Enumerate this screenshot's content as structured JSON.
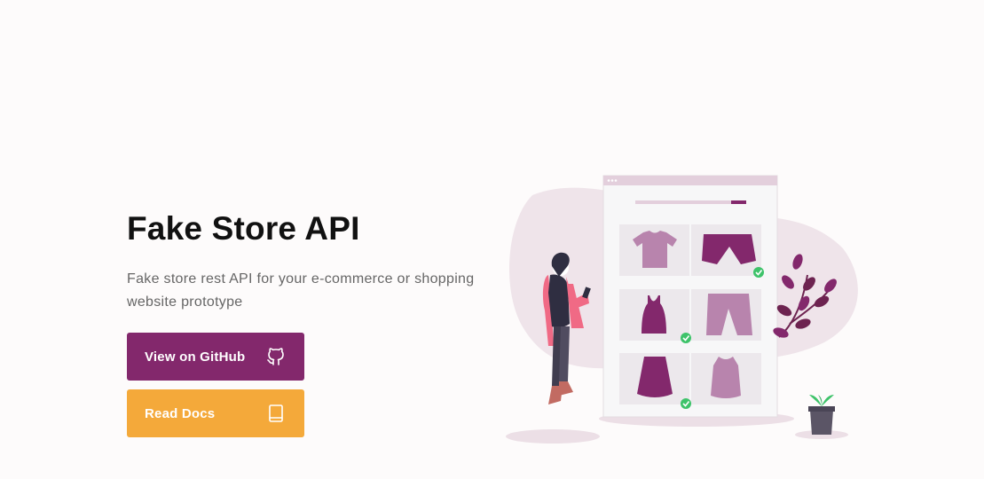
{
  "hero": {
    "title": "Fake Store API",
    "subtitle": "Fake store rest API for your e-commerce or shopping website prototype"
  },
  "buttons": {
    "github_label": "View on GitHub",
    "github_icon": "github-icon",
    "docs_label": "Read Docs",
    "docs_icon": "book-icon"
  },
  "colors": {
    "primary": "#83286c",
    "secondary": "#f4a93a",
    "background": "#fdfbfb",
    "title": "#111111",
    "subtitle": "#666666"
  },
  "illustration": {
    "description_icon": "online-shopping-illustration"
  }
}
